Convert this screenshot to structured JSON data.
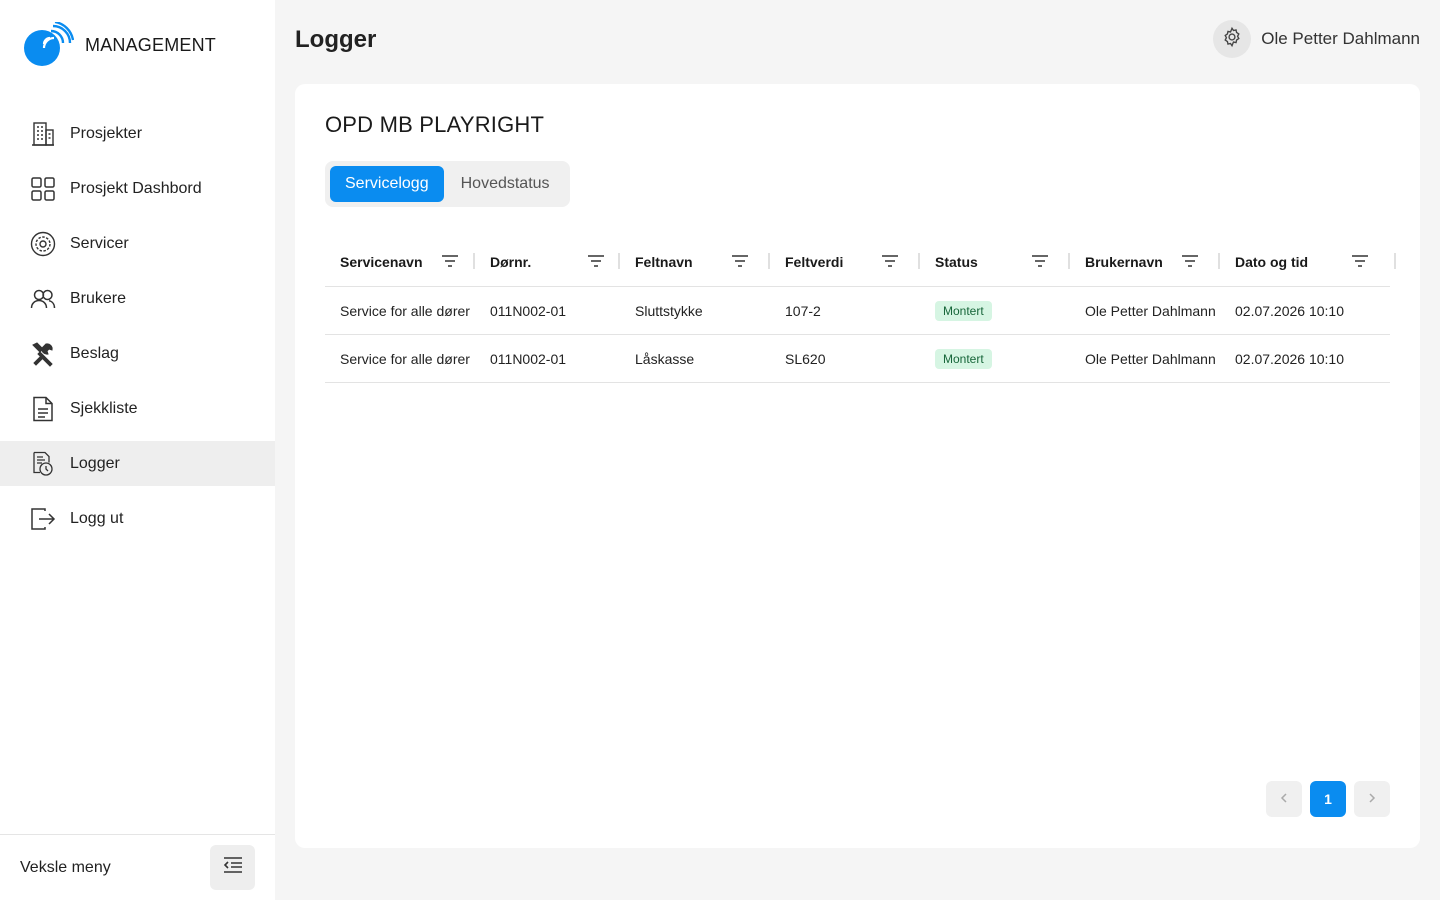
{
  "app": {
    "name": "MANAGEMENT"
  },
  "sidebar": {
    "items": [
      {
        "label": "Prosjekter",
        "icon": "building-icon"
      },
      {
        "label": "Prosjekt Dashbord",
        "icon": "dashboard-grid-icon"
      },
      {
        "label": "Servicer",
        "icon": "service-gear-icon"
      },
      {
        "label": "Brukere",
        "icon": "users-icon"
      },
      {
        "label": "Beslag",
        "icon": "tools-icon"
      },
      {
        "label": "Sjekkliste",
        "icon": "document-icon"
      },
      {
        "label": "Logger",
        "icon": "log-clock-icon",
        "active": true
      },
      {
        "label": "Logg ut",
        "icon": "logout-icon"
      }
    ],
    "footer": {
      "label": "Veksle meny",
      "icon": "menu-collapse-icon"
    }
  },
  "header": {
    "title": "Logger",
    "user_name": "Ole Petter Dahlmann",
    "settings_icon": "gear-icon"
  },
  "main": {
    "project_title": "OPD MB PLAYRIGHT",
    "tabs": [
      {
        "label": "Servicelogg",
        "active": true
      },
      {
        "label": "Hovedstatus",
        "active": false
      }
    ],
    "table": {
      "columns": [
        "Servicenavn",
        "Dørnr.",
        "Feltnavn",
        "Feltverdi",
        "Status",
        "Brukernavn",
        "Dato og tid"
      ],
      "rows": [
        {
          "servicenavn": "Service for alle dører",
          "dornr": "011N002-01",
          "feltnavn": "Sluttstykke",
          "feltverdi": "107-2",
          "status": "Montert",
          "brukernavn": "Ole Petter Dahlmann",
          "dato": "02.07.2026 10:10"
        },
        {
          "servicenavn": "Service for alle dører",
          "dornr": "011N002-01",
          "feltnavn": "Låskasse",
          "feltverdi": "SL620",
          "status": "Montert",
          "brukernavn": "Ole Petter Dahlmann",
          "dato": "02.07.2026 10:10"
        }
      ]
    },
    "pagination": {
      "current_page": "1"
    }
  },
  "colors": {
    "accent": "#0a8cf0",
    "status_bg": "#d6f5e3",
    "status_text": "#17663a",
    "active_nav_bg": "#eeeeee"
  }
}
